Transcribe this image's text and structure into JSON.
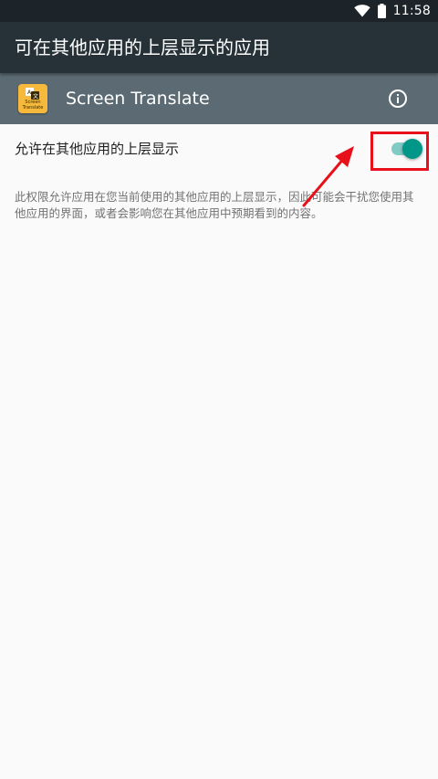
{
  "status_bar": {
    "time": "11:58"
  },
  "app_bar": {
    "title": "可在其他应用的上层显示的应用"
  },
  "app_header": {
    "app_name": "Screen Translate",
    "icon_label_line1": "Screen",
    "icon_label_line2": "Translate"
  },
  "setting": {
    "label": "允许在其他应用的上层显示",
    "enabled": true
  },
  "description": "此权限允许应用在您当前使用的其他应用的上层显示，因此可能会干扰您使用其他应用的界面，或者会影响您在其他应用中预期看到的内容。",
  "colors": {
    "status_bar": "#1c2429",
    "app_bar": "#263238",
    "app_header": "#5c6b73",
    "toggle_accent": "#009688",
    "toggle_track": "#80cbc4",
    "annotation": "#e8101a",
    "app_icon": "#f6b93b"
  },
  "icons": {
    "wifi": "wifi-icon",
    "battery": "battery-icon",
    "info": "info-icon",
    "app": "screen-translate-app-icon"
  }
}
